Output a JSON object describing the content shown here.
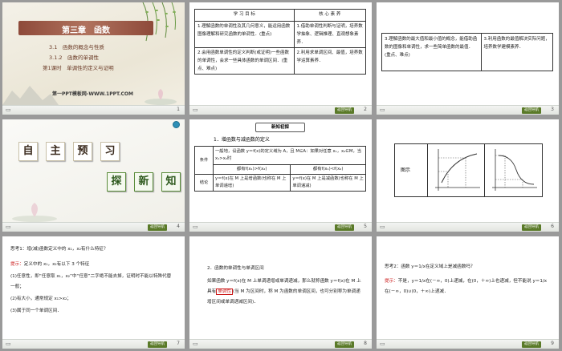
{
  "slides": [
    {
      "number": "1",
      "chapter": "第三章　函数",
      "sub1": "3.1　函数的概念与性质",
      "sub2": "3.1.2　函数的单调性",
      "sub3": "第1课时　单调性的定义与证明",
      "logo": "第一PPT模板网-WWW.1PPT.COM"
    },
    {
      "number": "2",
      "head_left": "学 习 目 标",
      "head_right": "核 心 素 养",
      "rows": [
        {
          "left": "1.理解函数的单调性及其几何意义，能运用函数图像理解和研究函数的单调性．(重点)",
          "right": "1.借助单调性判断与证明，培养数学抽象、逻辑推理、直观想象素养．"
        },
        {
          "left": "2.会用函数单调性的定义判断(或证明)一些函数的单调性，会求一些具体函数的单调区间．(重点、难点)",
          "right": "2.利用求单调区间、最值，培养数学运算素养．"
        }
      ]
    },
    {
      "number": "3",
      "left": "3.理解函数的最大值和最小值的概念，能借助函数的图像和单调性，求一些简单函数的最值．(重点、难点)",
      "right": "3.利用函数的最值解决实际问题，培养数学建模素养．"
    },
    {
      "number": "4",
      "row1": [
        "自",
        "主",
        "预",
        "习"
      ],
      "row2": [
        "探",
        "新",
        "知"
      ]
    },
    {
      "number": "5",
      "badge": "新知初探",
      "title": "1．增函数与减函数的定义",
      "cond_label": "条件",
      "cond_text": "一般地，设函数 y＝f(x)的定义域为 A，且 M⊆A：如果对任意 x₁，x₂∈M，当 x₁>x₂时",
      "incr": "都有f(x₁)>f(x₂)",
      "decr": "都有f(x₁)<f(x₂)",
      "concl_label": "结论",
      "concl_incr": "y＝f(x)在 M 上是增函数(也称在 M 上单调递增)",
      "concl_decr": "y＝f(x)在 M 上是减函数(也称在 M 上单调递减)"
    },
    {
      "number": "6",
      "label": "图示"
    },
    {
      "number": "7",
      "q": "思考1：增(减)函数定义中的 x₁，x₂有什么特征？",
      "hint": "提示：",
      "l1": "定义中的 x₁，x₂有以下 3 个特征",
      "l2": "(1)任意性，即“任意取 x₁，x₂”中“任意”二字绝不能去掉，证明时不能以特殊代替一般；",
      "l3": "(2)有大小，通常规定 x₁>x₂；",
      "l4": "(3)属于同一个单调区间．"
    },
    {
      "number": "8",
      "title": "2．函数的单调性与单调区间",
      "p1a": "如果函数 y＝f(x)在 M 上单调递增或单调递减，那么就称函数 y＝f(x)在 M 上具有",
      "p1b": "单调性",
      "p1c": "(当 M 为区间时，称 M 为函数的单调区间，也可分别称为单调递增区间或单调递减区间)．"
    },
    {
      "number": "9",
      "q": "思考2：函数 y＝1/x在定义域上是减函数吗？",
      "hint": "提示：",
      "a1": "不是，y＝1/x在(－∞，0)上递减，在(0，＋∞)上也递减，但不能说 y＝1/x在(－∞，0)∪(0，＋∞)上递减．"
    }
  ],
  "colors": {
    "banner": "#9b5543",
    "badge": "#5a7a28",
    "red": "#cc1b1b"
  },
  "icons": {
    "left_footer": "book-icon",
    "right_footer": "return-tag"
  },
  "footer_tag": "返回导航"
}
